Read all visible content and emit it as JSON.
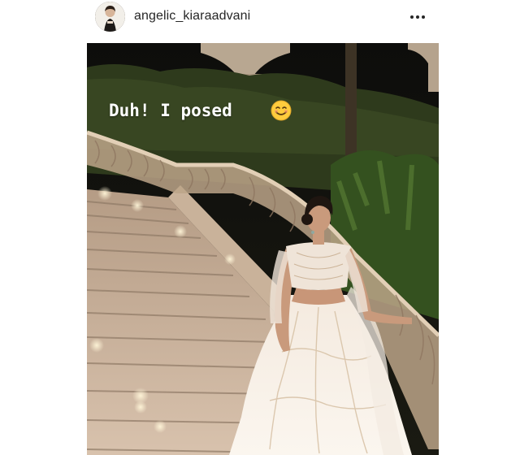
{
  "post": {
    "username": "angelic_kiaraadvani",
    "avatar_icon": "profile-photo-avatar",
    "more_icon": "more-options-dots-icon"
  },
  "story": {
    "caption": "Duh! I posed",
    "caption_emoji": "smiling-face-emoji",
    "scene": "woman in white embellished lehenga posing on a lit marble staircase at night"
  }
}
